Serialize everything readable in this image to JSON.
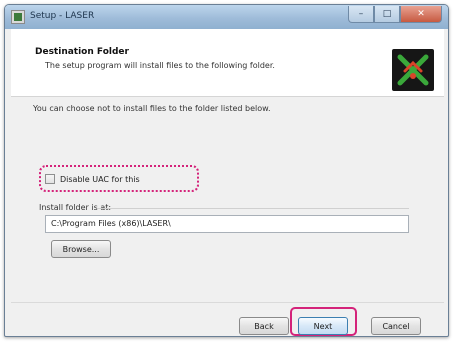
{
  "window": {
    "title": "Setup - LASER",
    "controls": {
      "minimize": "–",
      "maximize": "□",
      "close": "✕"
    }
  },
  "header": {
    "title": "Destination Folder",
    "subtitle": "The setup program will install files to the following folder."
  },
  "body": {
    "intro": "You can choose not to install files to the folder listed below."
  },
  "checkbox": {
    "label": "Disable UAC for this",
    "checked": false
  },
  "destination": {
    "group_label": "Install folder is at:",
    "path": "C:\\Program Files (x86)\\LASER\\",
    "browse_label": "Browse..."
  },
  "footer": {
    "back_label": "Back",
    "next_label": "Next",
    "cancel_label": "Cancel"
  },
  "colors": {
    "highlight": "#d4237a",
    "logo_bg": "#161616",
    "logo_green": "#3aa83a",
    "logo_red": "#d9442a"
  }
}
